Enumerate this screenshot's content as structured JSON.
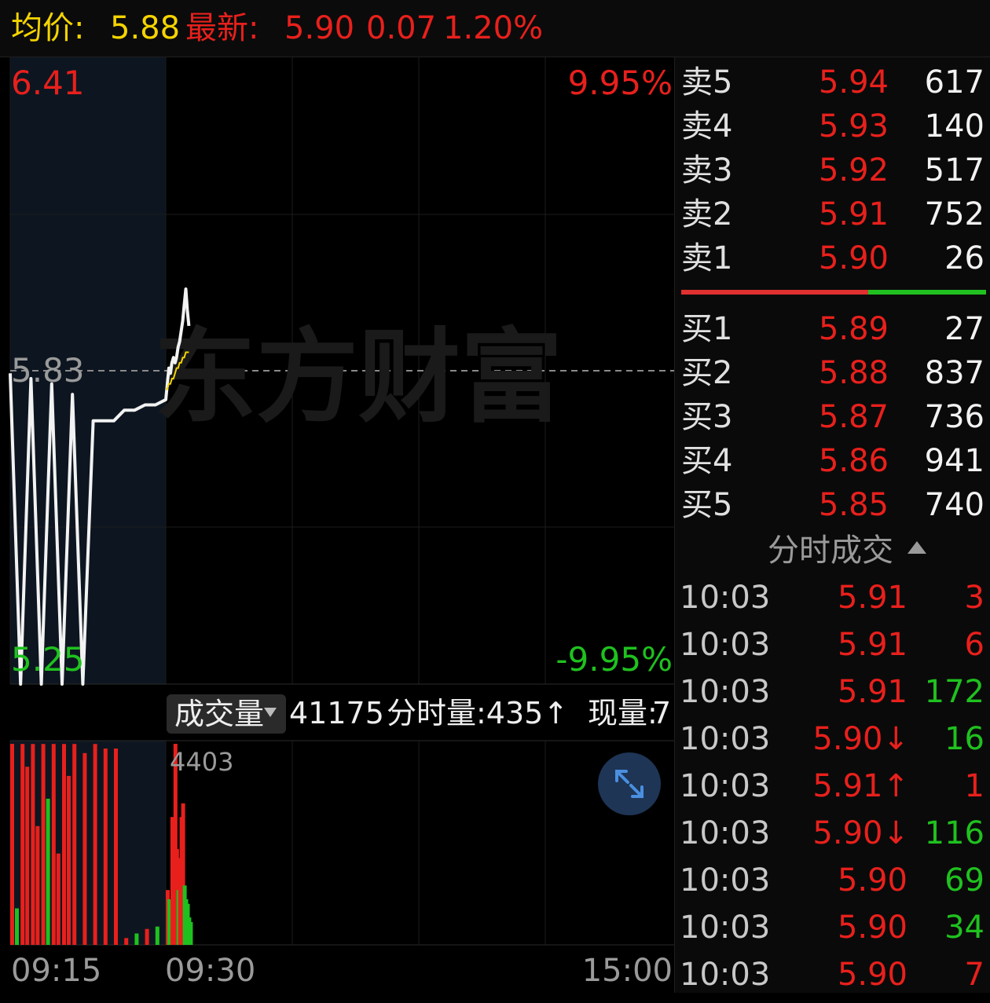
{
  "header": {
    "avg_label": "均价:",
    "avg_value": "5.88",
    "latest_label": "最新:",
    "latest_value": "5.90",
    "change": "0.07",
    "change_pct": "1.20%"
  },
  "chart_data": {
    "type": "line",
    "title": "",
    "y_max_label": "6.41",
    "y_mid_label": "5.83",
    "y_min_label": "5.25",
    "pct_max_label": "9.95%",
    "pct_min_label": "-9.95%",
    "ylim": [
      5.25,
      6.41
    ],
    "prev_close": 5.83,
    "x_ticks": [
      "09:15",
      "09:30",
      "15:00"
    ],
    "series": [
      {
        "name": "最新",
        "x": [
          "09:15",
          "09:16",
          "09:17",
          "09:18",
          "09:19",
          "09:20",
          "09:21",
          "09:22",
          "09:23",
          "09:24",
          "09:25",
          "09:26",
          "09:27",
          "09:28",
          "09:29",
          "09:30",
          "09:31",
          "09:32",
          "09:33",
          "09:34",
          "09:35",
          "09:36",
          "09:37",
          "09:38",
          "09:39",
          "09:40",
          "09:41",
          "09:42",
          "09:43",
          "09:44",
          "09:45"
        ],
        "values": [
          5.84,
          5.25,
          5.83,
          5.25,
          5.82,
          5.25,
          5.8,
          5.25,
          5.75,
          5.75,
          5.75,
          5.77,
          5.77,
          5.78,
          5.78,
          5.79,
          5.82,
          5.85,
          5.84,
          5.86,
          5.87,
          5.86,
          5.87,
          5.89,
          5.9,
          5.92,
          5.94,
          5.97,
          6.0,
          5.96,
          5.93
        ]
      },
      {
        "name": "均价",
        "x": [
          "09:30",
          "09:31",
          "09:32",
          "09:33",
          "09:34",
          "09:35",
          "09:36",
          "09:37",
          "09:38",
          "09:39",
          "09:40",
          "09:41",
          "09:42",
          "09:43",
          "09:44",
          "09:45"
        ],
        "values": [
          5.81,
          5.81,
          5.82,
          5.82,
          5.83,
          5.83,
          5.84,
          5.85,
          5.85,
          5.86,
          5.86,
          5.87,
          5.87,
          5.88,
          5.88,
          5.88
        ]
      }
    ]
  },
  "volume": {
    "selector_label": "成交量",
    "total": "41175",
    "tick_vol": "分时量:435↑",
    "current_label": "现量:",
    "current_value": "7",
    "max_label": "4403",
    "chart_data": {
      "type": "bar",
      "ylim": [
        0,
        4403
      ],
      "bars": [
        {
          "t": "09:15",
          "v": 4403,
          "c": "red"
        },
        {
          "t": "09:15",
          "v": 800,
          "c": "green"
        },
        {
          "t": "09:16",
          "v": 4400,
          "c": "red"
        },
        {
          "t": "09:16",
          "v": 3900,
          "c": "red"
        },
        {
          "t": "09:17",
          "v": 4400,
          "c": "red"
        },
        {
          "t": "09:17",
          "v": 2600,
          "c": "red"
        },
        {
          "t": "09:18",
          "v": 4400,
          "c": "red"
        },
        {
          "t": "09:18",
          "v": 3200,
          "c": "green"
        },
        {
          "t": "09:19",
          "v": 4400,
          "c": "red"
        },
        {
          "t": "09:19",
          "v": 2000,
          "c": "red"
        },
        {
          "t": "09:20",
          "v": 4400,
          "c": "red"
        },
        {
          "t": "09:20",
          "v": 3700,
          "c": "red"
        },
        {
          "t": "09:21",
          "v": 4400,
          "c": "red"
        },
        {
          "t": "09:22",
          "v": 4200,
          "c": "red"
        },
        {
          "t": "09:23",
          "v": 4400,
          "c": "red"
        },
        {
          "t": "09:24",
          "v": 4300,
          "c": "red"
        },
        {
          "t": "09:25",
          "v": 4300,
          "c": "red"
        },
        {
          "t": "09:26",
          "v": 150,
          "c": "red"
        },
        {
          "t": "09:27",
          "v": 250,
          "c": "green"
        },
        {
          "t": "09:28",
          "v": 350,
          "c": "red"
        },
        {
          "t": "09:29",
          "v": 400,
          "c": "green"
        },
        {
          "t": "09:30",
          "v": 1200,
          "c": "red"
        },
        {
          "t": "09:30",
          "v": 2000,
          "c": "red"
        },
        {
          "t": "09:31",
          "v": 1000,
          "c": "green"
        },
        {
          "t": "09:31",
          "v": 1500,
          "c": "red"
        },
        {
          "t": "09:32",
          "v": 900,
          "c": "green"
        },
        {
          "t": "09:33",
          "v": 2800,
          "c": "red"
        },
        {
          "t": "09:34",
          "v": 1800,
          "c": "red"
        },
        {
          "t": "09:35",
          "v": 4403,
          "c": "red"
        },
        {
          "t": "09:36",
          "v": 2100,
          "c": "red"
        },
        {
          "t": "09:37",
          "v": 1200,
          "c": "green"
        },
        {
          "t": "09:38",
          "v": 1900,
          "c": "red"
        },
        {
          "t": "09:39",
          "v": 2800,
          "c": "red"
        },
        {
          "t": "09:40",
          "v": 3100,
          "c": "red"
        },
        {
          "t": "09:41",
          "v": 1300,
          "c": "green"
        },
        {
          "t": "09:42",
          "v": 1000,
          "c": "green"
        },
        {
          "t": "09:43",
          "v": 900,
          "c": "green"
        },
        {
          "t": "09:44",
          "v": 600,
          "c": "green"
        },
        {
          "t": "09:45",
          "v": 500,
          "c": "green"
        }
      ]
    }
  },
  "watermark": "东方财富",
  "order_book": {
    "asks": [
      {
        "label": "卖5",
        "price": "5.94",
        "vol": "617"
      },
      {
        "label": "卖4",
        "price": "5.93",
        "vol": "140"
      },
      {
        "label": "卖3",
        "price": "5.92",
        "vol": "517"
      },
      {
        "label": "卖2",
        "price": "5.91",
        "vol": "752"
      },
      {
        "label": "卖1",
        "price": "5.90",
        "vol": "26"
      }
    ],
    "bids": [
      {
        "label": "买1",
        "price": "5.89",
        "vol": "27"
      },
      {
        "label": "买2",
        "price": "5.88",
        "vol": "837"
      },
      {
        "label": "买3",
        "price": "5.87",
        "vol": "736"
      },
      {
        "label": "买4",
        "price": "5.86",
        "vol": "941"
      },
      {
        "label": "买5",
        "price": "5.85",
        "vol": "740"
      }
    ]
  },
  "ticks": {
    "title": "分时成交",
    "rows": [
      {
        "time": "10:03",
        "price": "5.91",
        "vol": "3",
        "color": "red"
      },
      {
        "time": "10:03",
        "price": "5.91",
        "vol": "6",
        "color": "red"
      },
      {
        "time": "10:03",
        "price": "5.91",
        "vol": "172",
        "color": "green"
      },
      {
        "time": "10:03",
        "price": "5.90↓",
        "vol": "16",
        "color": "green"
      },
      {
        "time": "10:03",
        "price": "5.91↑",
        "vol": "1",
        "color": "red"
      },
      {
        "time": "10:03",
        "price": "5.90↓",
        "vol": "116",
        "color": "green"
      },
      {
        "time": "10:03",
        "price": "5.90",
        "vol": "69",
        "color": "green"
      },
      {
        "time": "10:03",
        "price": "5.90",
        "vol": "34",
        "color": "green"
      },
      {
        "time": "10:03",
        "price": "5.90",
        "vol": "7",
        "color": "red"
      }
    ]
  },
  "colors": {
    "up": "#e8201c",
    "down": "#1fc11f",
    "avg_line": "#f4d400",
    "price_line": "#ffffff",
    "bg": "#000000"
  }
}
